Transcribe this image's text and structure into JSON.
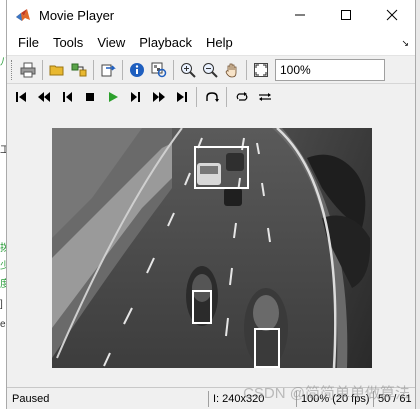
{
  "window": {
    "title": "Movie Player",
    "controls": [
      "minimize",
      "maximize",
      "close"
    ]
  },
  "menu": {
    "items": [
      "File",
      "Tools",
      "View",
      "Playback",
      "Help"
    ]
  },
  "toolbar": {
    "zoom_value": "100%"
  },
  "video": {
    "description_of_boxes": 4
  },
  "status": {
    "state": "Paused",
    "resolution": "I: 240x320",
    "zoom_fps": "100% (20 fps)",
    "frame": "50 / 61"
  },
  "watermark": "CSDN @简简单单做算法",
  "colors": {
    "titlebar": "#ffffff",
    "chrome": "#f0f0f0",
    "play_green": "#2ca02c",
    "info_blue": "#1f5fbf",
    "folder_yellow": "#e8b830"
  }
}
